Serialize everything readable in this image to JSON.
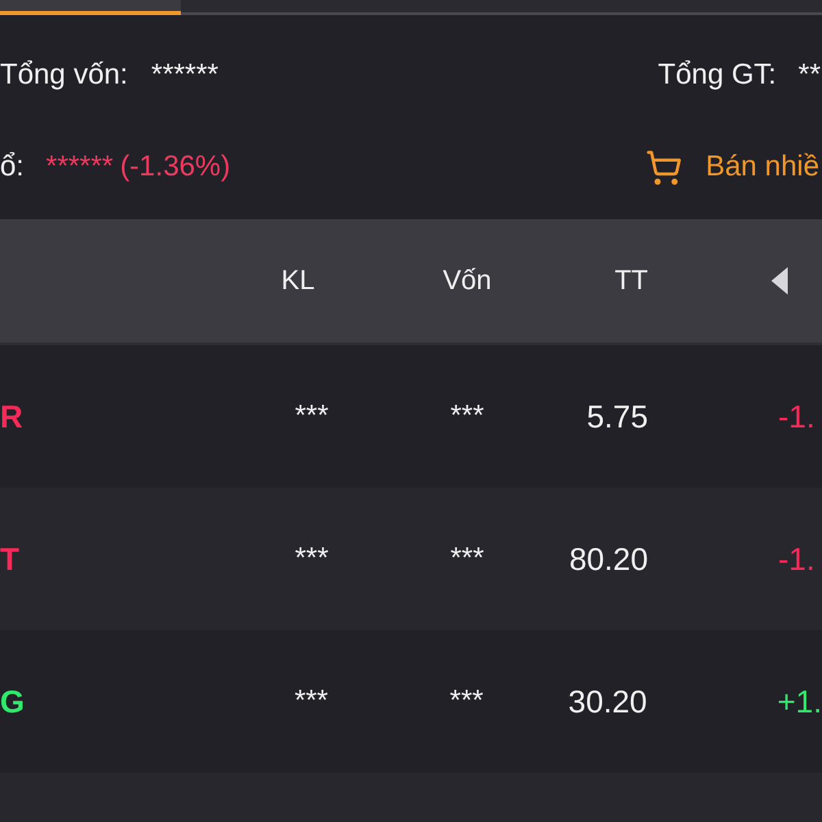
{
  "tabs": [
    {
      "selected": true
    },
    {
      "selected": false
    }
  ],
  "summary": {
    "total_capital": {
      "label": "Tổng vốn:",
      "value": "******"
    },
    "total_value": {
      "label": "Tổng GT:",
      "value": "**"
    },
    "profit_loss": {
      "label": "ổ:",
      "value": "******",
      "change": "(-1.36%)",
      "color": "#ec3a5e"
    },
    "sell_button": {
      "label": "Bán nhiề"
    }
  },
  "table": {
    "columns": [
      {
        "label": "KL"
      },
      {
        "label": "Vốn"
      },
      {
        "label": "TT"
      }
    ],
    "rows": [
      {
        "symbol": "R",
        "volume": "***",
        "capital": "***",
        "price": "5.75",
        "change": "-1.",
        "color": "#f52a58"
      },
      {
        "symbol": "T",
        "volume": "***",
        "capital": "***",
        "price": "80.20",
        "change": "-1.",
        "color": "#f52a58"
      },
      {
        "symbol": "G",
        "volume": "***",
        "capital": "***",
        "price": "30.20",
        "change": "+1.",
        "color": "#30e86c"
      }
    ]
  }
}
